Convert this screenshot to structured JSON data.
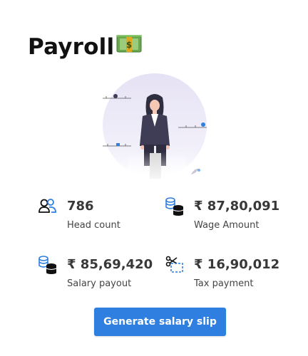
{
  "header": {
    "title": "Payroll",
    "icon": "money-bill-emoji-icon"
  },
  "illustration": "person-sitting-on-stool-illustration",
  "stats": [
    {
      "value": "786",
      "label": "Head count",
      "icon": "employee-count-icon"
    },
    {
      "value": "₹ 87,80,091",
      "label": "Wage Amount",
      "icon": "coins-stack-icon"
    },
    {
      "value": "₹ 85,69,420",
      "label": "Salary payout",
      "icon": "coins-stack-icon"
    },
    {
      "value": "₹ 16,90,012",
      "label": "Tax payment",
      "icon": "scissors-cut-icon"
    }
  ],
  "actions": {
    "generate_label": "Generate salary slip"
  },
  "colors": {
    "accent": "#2f7fe0",
    "title": "#111111",
    "value": "#383838",
    "label": "#444444"
  }
}
